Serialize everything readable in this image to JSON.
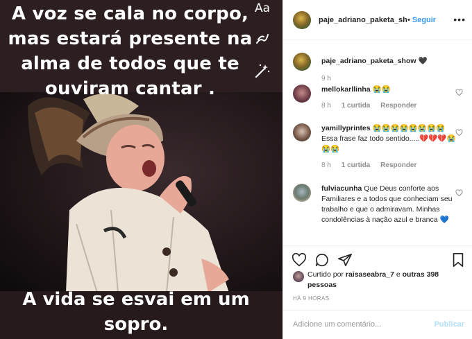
{
  "story": {
    "caption_top": [
      "A voz se cala no corpo,",
      "mas estará presente na",
      "alma de todos que te",
      "ouviram cantar ."
    ],
    "caption_bottom": [
      "A vida se esvai em um",
      "sopro."
    ],
    "tool_text_label": "Aa"
  },
  "header": {
    "username": "paje_adriano_paketa_show",
    "separator": "•",
    "follow_label": "Seguir",
    "more_icon": "more-horizontal-icon"
  },
  "owner_caption": {
    "username": "paje_adriano_paketa_show",
    "text": "🖤",
    "time": "9 h"
  },
  "comments": [
    {
      "username": "mellokarllinha",
      "text": "😭😭",
      "time": "8 h",
      "likes": "1 curtida",
      "reply": "Responder"
    },
    {
      "username": "yamillyprintes",
      "text": "😭😭😭😭😭😭😭😭 Essa frase faz todo sentido.....💔💔💔😭😭😭",
      "time": "8 h",
      "likes": "1 curtida",
      "reply": "Responder"
    },
    {
      "username": "fulviacunha",
      "text": "Que Deus conforte aos Familiares e a todos que conheciam seu trabalho e que o admiravam. Minhas condolências à nação azul e branca 💙"
    }
  ],
  "likes": {
    "prefix": "Curtido por",
    "user": "raisaseabra_7",
    "conj": "e",
    "others": "outras 398 pessoas"
  },
  "timestamp": "HÁ 9 HORAS",
  "add_comment": {
    "placeholder": "Adicione um comentário...",
    "post_label": "Publicar"
  },
  "colors": {
    "link_blue": "#3897f0",
    "post_disabled": "#b2dffc",
    "muted": "#8e8e8e",
    "text": "#262626"
  }
}
